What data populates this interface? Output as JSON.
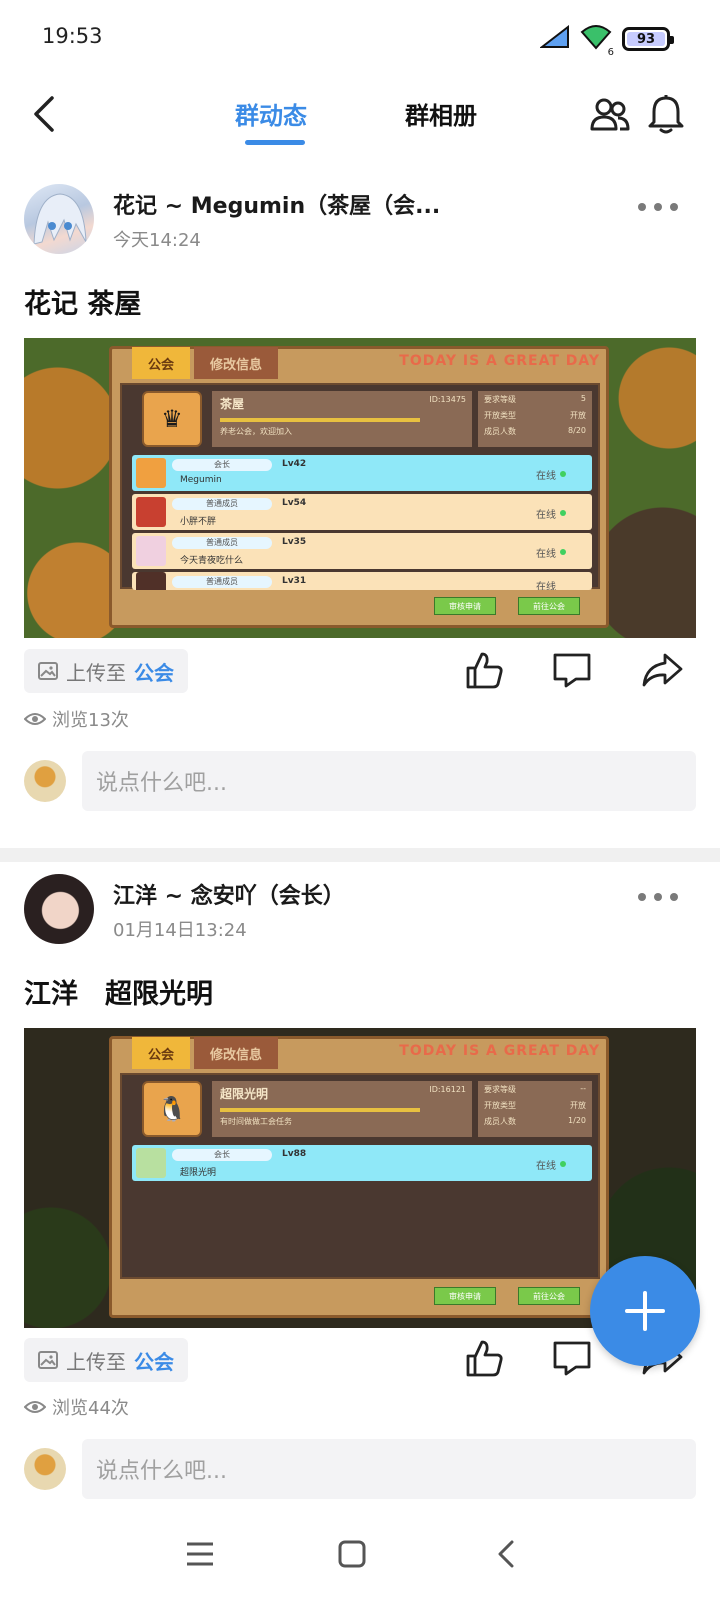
{
  "status_bar": {
    "time": "19:53",
    "battery": "93",
    "wifi_badge": "6"
  },
  "header": {
    "tabs": [
      {
        "label": "群动态",
        "active": true
      },
      {
        "label": "群相册",
        "active": false
      }
    ],
    "accent_color": "#3b8be6",
    "icons": [
      "back-arrow-icon",
      "group-members-icon",
      "bell-icon"
    ]
  },
  "posts": [
    {
      "author": "花记 ~ Megumin（茶屋（会...",
      "time": "今天14:24",
      "title": "花记 茶屋",
      "upload_prefix": "上传至",
      "upload_target": "公会",
      "views": "浏览13次",
      "comment_placeholder": "说点什么吧...",
      "screenshot": {
        "tab_guild": "公会",
        "tab_edit": "修改信息",
        "banner": "TODAY IS A GREAT DAY",
        "guild_name": "茶屋",
        "guild_id": "ID:13475",
        "guild_desc": "养老公会，欢迎加入",
        "req": [
          {
            "k": "要求等级",
            "v": "5"
          },
          {
            "k": "开放类型",
            "v": "开放"
          },
          {
            "k": "成员人数",
            "v": "8/20"
          }
        ],
        "members": [
          {
            "role": "会长",
            "level": "Lv42",
            "name": "Megumin",
            "status": "在线"
          },
          {
            "role": "普通成员",
            "level": "Lv54",
            "name": "小胖不胖",
            "status": "在线"
          },
          {
            "role": "普通成员",
            "level": "Lv35",
            "name": "今天青夜吃什么",
            "status": "在线"
          },
          {
            "role": "普通成员",
            "level": "Lv31",
            "name": "",
            "status": "在线"
          }
        ],
        "btn_review": "审核申请",
        "btn_goto": "前往公会"
      }
    },
    {
      "author": "江洋 ~ 念安吖（会长）",
      "time": "01月14日13:24",
      "title": "江洋　超限光明",
      "upload_prefix": "上传至",
      "upload_target": "公会",
      "views": "浏览44次",
      "comment_placeholder": "说点什么吧...",
      "screenshot": {
        "tab_guild": "公会",
        "tab_edit": "修改信息",
        "banner": "TODAY IS A GREAT DAY",
        "guild_name": "超限光明",
        "guild_id": "ID:16121",
        "guild_desc": "有时间做做工会任务",
        "req": [
          {
            "k": "要求等级",
            "v": "--"
          },
          {
            "k": "开放类型",
            "v": "开放"
          },
          {
            "k": "成员人数",
            "v": "1/20"
          }
        ],
        "members": [
          {
            "role": "会长",
            "level": "Lv88",
            "name": "超限光明",
            "status": "在线"
          }
        ],
        "btn_review": "审核申请",
        "btn_goto": "前往公会"
      }
    }
  ],
  "fab": {
    "icon": "plus-icon"
  },
  "nav": {
    "icons": [
      "menu-icon",
      "home-square-icon",
      "back-chevron-icon"
    ]
  }
}
